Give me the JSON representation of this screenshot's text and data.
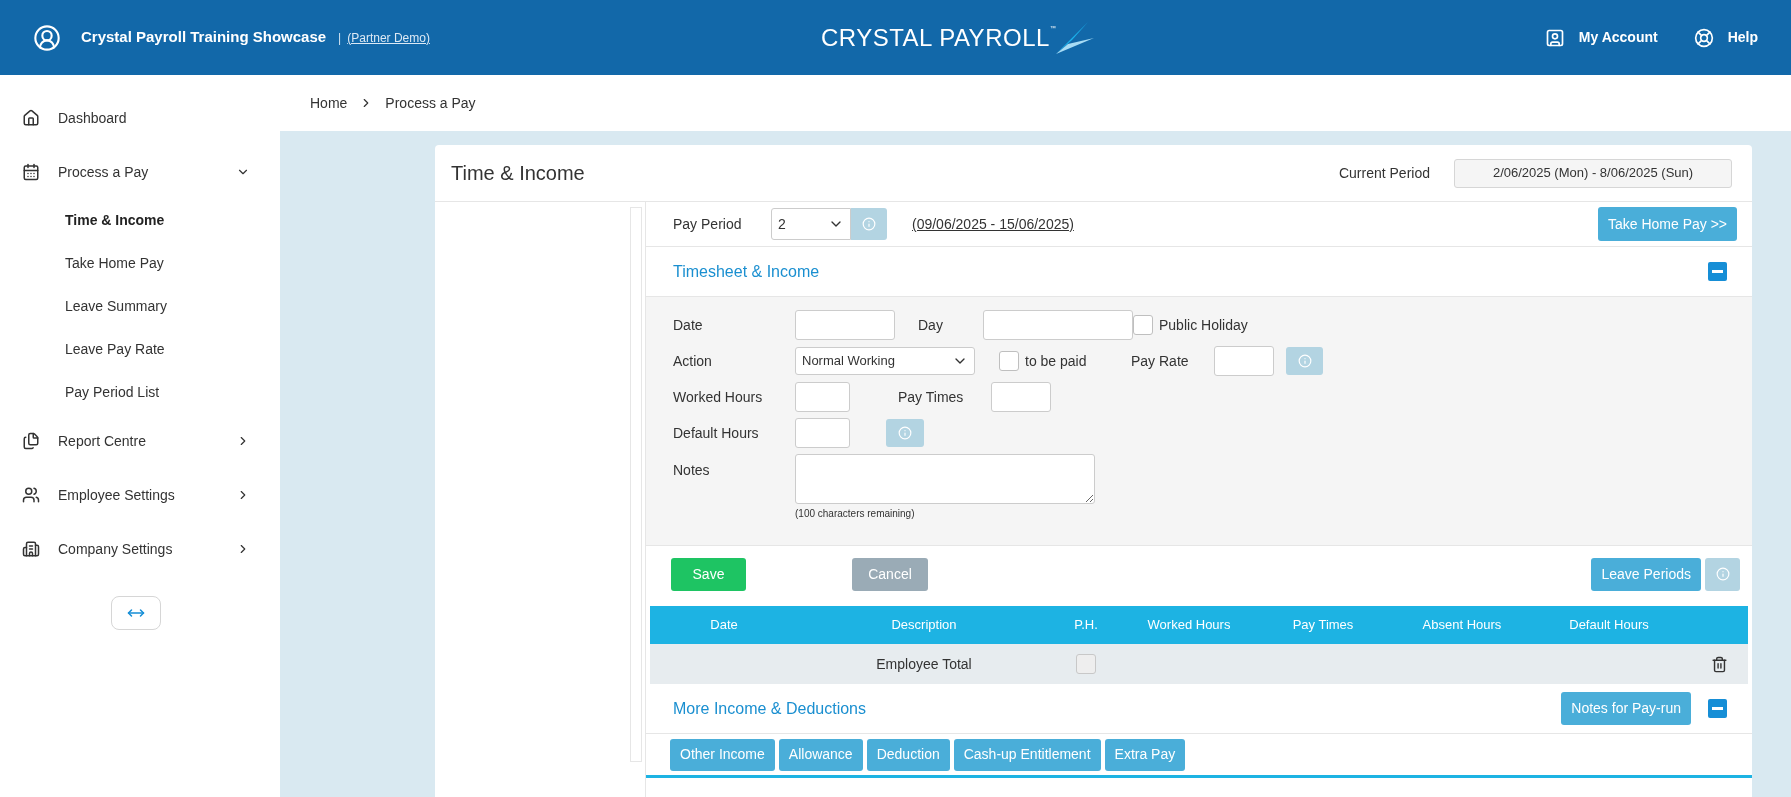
{
  "header": {
    "company": "Crystal Payroll Training Showcase",
    "separator": "|",
    "mode_link": "(Partner Demo)",
    "logo": {
      "text": "CRYSTAL PAYROLL",
      "mark": "™"
    },
    "actions": [
      {
        "kind": "account",
        "label": "My Account"
      },
      {
        "kind": "help",
        "label": "Help"
      }
    ]
  },
  "sidebar": {
    "items": [
      {
        "kind": "home",
        "label": "Dashboard"
      },
      {
        "kind": "calendar",
        "label": "Process a Pay",
        "expanded": true,
        "children": [
          {
            "label": "Time & Income",
            "selected": true
          },
          {
            "label": "Take Home Pay",
            "selected": false
          },
          {
            "label": "Leave Summary",
            "selected": false
          },
          {
            "label": "Leave Pay Rate",
            "selected": false
          },
          {
            "label": "Pay Period List",
            "selected": false
          }
        ]
      },
      {
        "kind": "files",
        "label": "Report Centre",
        "expanded": false
      },
      {
        "kind": "people",
        "label": "Employee Settings",
        "expanded": false
      },
      {
        "kind": "building",
        "label": "Company Settings",
        "expanded": false
      }
    ]
  },
  "breadcrumb": [
    "Home",
    "Process a Pay"
  ],
  "page": {
    "title": "Time & Income",
    "current_period_label": "Current Period",
    "current_period": "2/06/2025 (Mon) - 8/06/2025 (Sun)"
  },
  "pay_period": {
    "label": "Pay Period",
    "value": "2",
    "range": "(09/06/2025 - 15/06/2025)",
    "button": "Take Home Pay >>"
  },
  "timesheet": {
    "title": "Timesheet & Income",
    "expanded": true,
    "date": {
      "label": "Date"
    },
    "day": {
      "label": "Day"
    },
    "public_holiday": {
      "label": "Public Holiday",
      "checked": false
    },
    "action": {
      "label": "Action",
      "value": "Normal Working"
    },
    "to_be_paid": {
      "label": "to be paid",
      "checked": false
    },
    "pay_rate": {
      "label": "Pay Rate"
    },
    "worked_hours": {
      "label": "Worked Hours"
    },
    "pay_times": {
      "label": "Pay Times"
    },
    "default_hours": {
      "label": "Default Hours"
    },
    "notes": {
      "label": "Notes",
      "hint": "(100 characters remaining)"
    },
    "save": "Save",
    "cancel": "Cancel",
    "leave_periods": "Leave Periods"
  },
  "table": {
    "columns": [
      "Date",
      "Description",
      "P.H.",
      "Worked Hours",
      "Pay Times",
      "Absent Hours",
      "Default Hours"
    ],
    "rows": [
      {
        "description": "Employee Total",
        "ph": false
      }
    ]
  },
  "more": {
    "title": "More Income & Deductions",
    "expanded": true,
    "notes_button": "Notes for Pay-run",
    "buttons": [
      "Other Income",
      "Allowance",
      "Deduction",
      "Cash-up Entitlement",
      "Extra Pay"
    ]
  }
}
